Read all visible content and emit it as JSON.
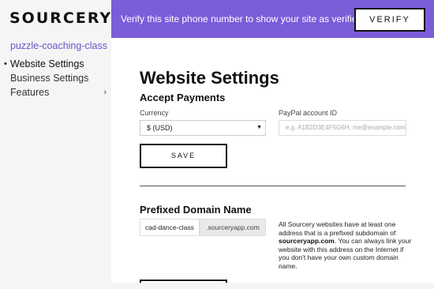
{
  "sidebar": {
    "logo": "SOURCERY",
    "site_name": "puzzle-coaching-class",
    "items": [
      {
        "label": "Website Settings",
        "bullet": "•",
        "chevron": ""
      },
      {
        "label": "Business Settings",
        "bullet": "",
        "chevron": ""
      },
      {
        "label": "Features",
        "bullet": "",
        "chevron": "›"
      }
    ]
  },
  "banner": {
    "message": "Verify this site phone number to show your site as verified.",
    "verify_label": "VERIFY",
    "color": "#7b5cd9"
  },
  "main": {
    "title": "Website Settings",
    "payments": {
      "heading": "Accept Payments",
      "currency_label": "Currency",
      "currency_value": "$ (USD)",
      "paypal_label": "PayPal account ID",
      "paypal_placeholder": "e.g. A1B2D3E4F5G6H, me@example.com",
      "save_label": "SAVE"
    },
    "domain": {
      "heading": "Prefixed Domain Name",
      "subdomain_value": "cad-dance-class",
      "suffix": ".sourceryapp.com",
      "desc_before": "All Sourcery websites have at least one address that is a prefixed subdomain of ",
      "desc_bold": "sourceryapp.com",
      "desc_after": ". You can always link your website with this address on the Internet if you don't have your own custom domain name."
    }
  }
}
